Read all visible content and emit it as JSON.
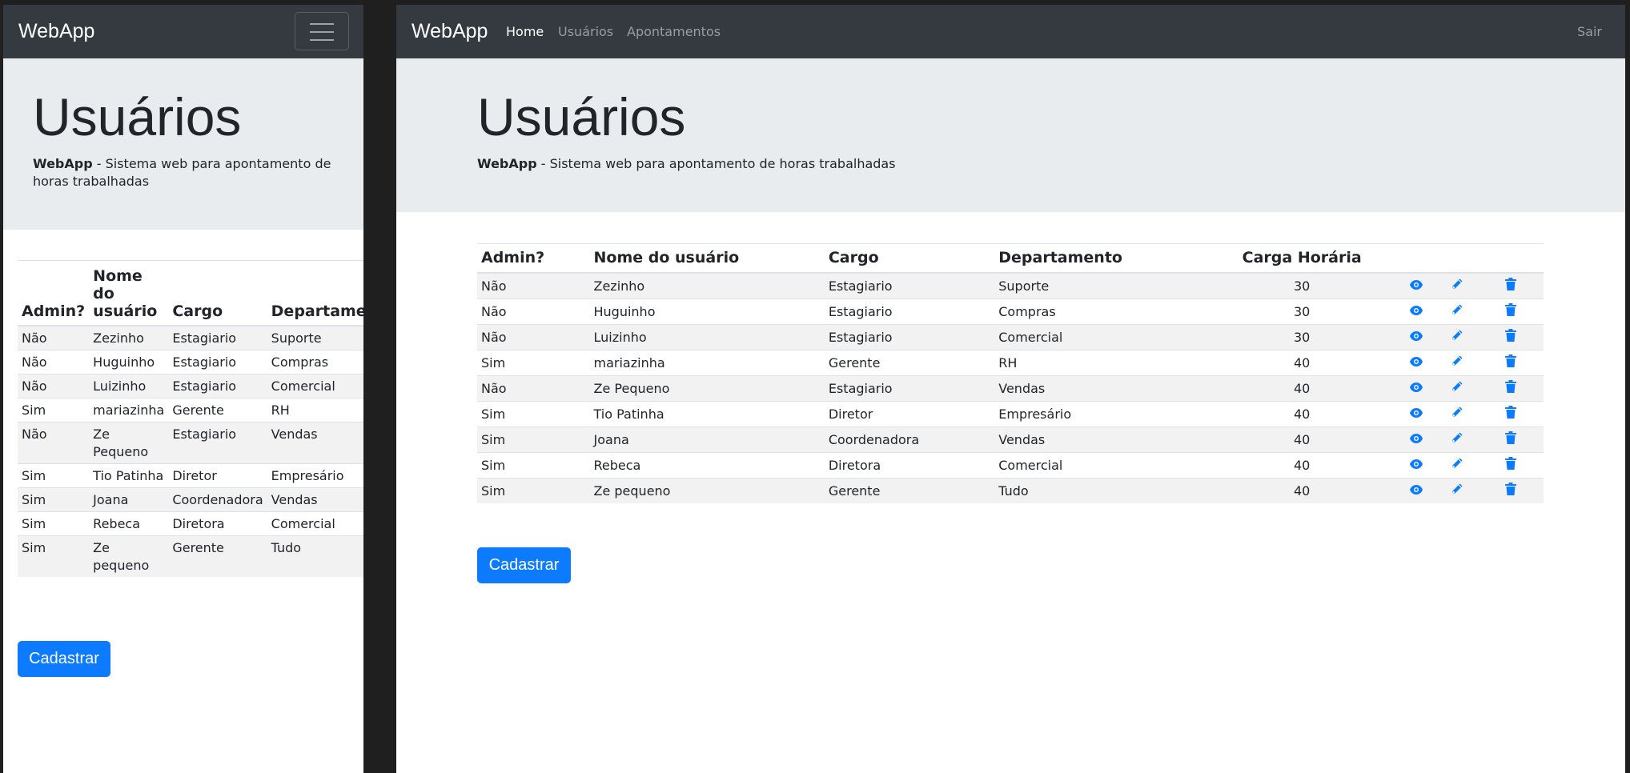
{
  "brand": "WebApp",
  "nav": {
    "home": "Home",
    "usuarios": "Usuários",
    "apontamentos": "Apontamentos",
    "sair": "Sair"
  },
  "jumbotron": {
    "title": "Usuários",
    "brand_bold": "WebApp",
    "subtitle": " - Sistema web para apontamento de horas trabalhadas"
  },
  "table": {
    "headers": {
      "admin": "Admin?",
      "nome": "Nome do usuário",
      "cargo": "Cargo",
      "departamento": "Departamento",
      "departamento_cut": "Departamen",
      "carga": "Carga Horária"
    },
    "rows": [
      {
        "admin": "Não",
        "nome": "Zezinho",
        "cargo": "Estagiario",
        "departamento": "Suporte",
        "carga": "30"
      },
      {
        "admin": "Não",
        "nome": "Huguinho",
        "cargo": "Estagiario",
        "departamento": "Compras",
        "carga": "30"
      },
      {
        "admin": "Não",
        "nome": "Luizinho",
        "cargo": "Estagiario",
        "departamento": "Comercial",
        "carga": "30"
      },
      {
        "admin": "Sim",
        "nome": "mariazinha",
        "cargo": "Gerente",
        "departamento": "RH",
        "carga": "40"
      },
      {
        "admin": "Não",
        "nome": "Ze Pequeno",
        "cargo": "Estagiario",
        "departamento": "Vendas",
        "carga": "40"
      },
      {
        "admin": "Sim",
        "nome": "Tio Patinha",
        "cargo": "Diretor",
        "departamento": "Empresário",
        "carga": "40"
      },
      {
        "admin": "Sim",
        "nome": "Joana",
        "cargo": "Coordenadora",
        "departamento": "Vendas",
        "carga": "40"
      },
      {
        "admin": "Sim",
        "nome": "Rebeca",
        "cargo": "Diretora",
        "departamento": "Comercial",
        "carga": "40"
      },
      {
        "admin": "Sim",
        "nome": "Ze pequeno",
        "cargo": "Gerente",
        "departamento": "Tudo",
        "carga": "40"
      }
    ]
  },
  "actions": {
    "view_icon": "eye-icon",
    "edit_icon": "pencil-icon",
    "delete_icon": "trash-icon"
  },
  "button": {
    "cadastrar": "Cadastrar"
  },
  "colors": {
    "navbar": "#343a40",
    "jumbotron": "#e9ecef",
    "primary": "#0d7bff",
    "stripe": "#f2f2f2"
  }
}
